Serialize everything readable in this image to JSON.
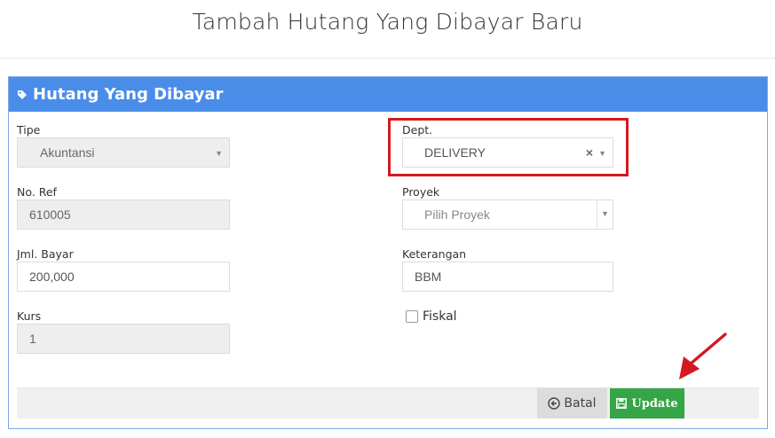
{
  "page": {
    "title": "Tambah Hutang Yang Dibayar Baru"
  },
  "panel": {
    "heading": "Hutang Yang Dibayar"
  },
  "form": {
    "tipe": {
      "label": "Tipe",
      "value": "Akuntansi"
    },
    "no_ref": {
      "label": "No. Ref",
      "value": "610005"
    },
    "jml_bayar": {
      "label": "Jml. Bayar",
      "value": "200,000"
    },
    "kurs": {
      "label": "Kurs",
      "value": "1"
    },
    "dept": {
      "label": "Dept.",
      "value": "DELIVERY",
      "clear": "×"
    },
    "proyek": {
      "label": "Proyek",
      "placeholder": "Pilih Proyek"
    },
    "keterangan": {
      "label": "Keterangan",
      "value": "BBM"
    },
    "fiskal": {
      "label": "Fiskal",
      "checked": false
    }
  },
  "actions": {
    "cancel_label": "Batal",
    "update_label": "Update"
  },
  "colors": {
    "header_blue": "#4a8de9",
    "update_green": "#35a547",
    "highlight_red": "#d4191f",
    "arrow_red": "#d4191f"
  },
  "icons": [
    "tag-icon",
    "chevron-down-icon",
    "clear-icon",
    "back-arrow-icon",
    "save-icon",
    "annotation-arrow"
  ]
}
